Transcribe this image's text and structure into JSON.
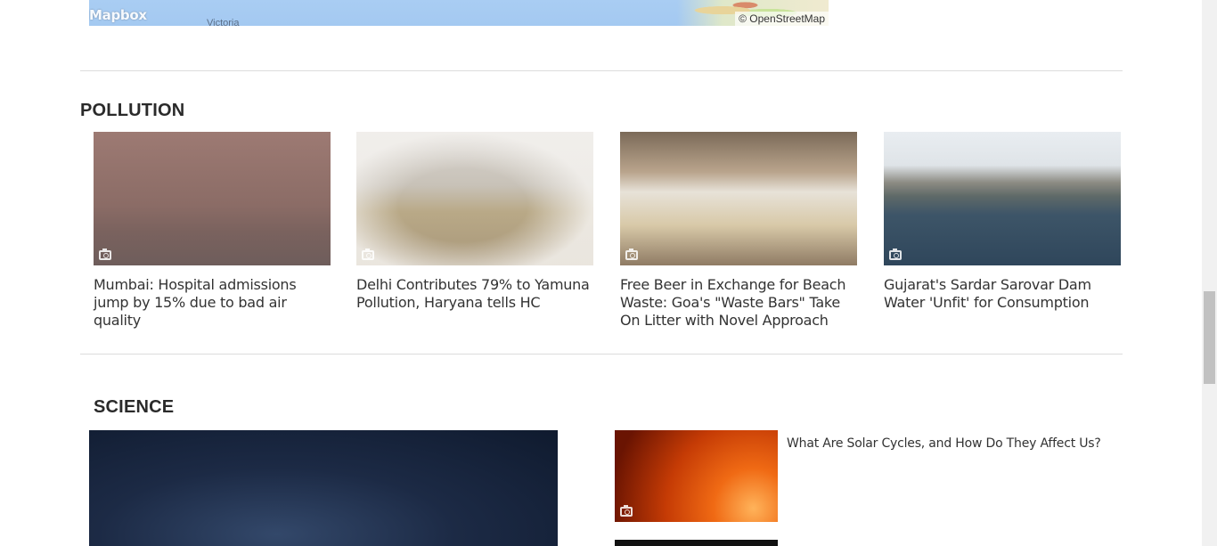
{
  "map": {
    "logo": "Mapbox",
    "city": "Victoria",
    "attribution": "© OpenStreetMap"
  },
  "sections": {
    "pollution": {
      "title": "POLLUTION",
      "cards": [
        {
          "title": "Mumbai: Hospital admissions jump by 15% due to bad air quality",
          "icon": "camera-icon"
        },
        {
          "title": "Delhi Contributes 79% to Yamuna Pollution, Haryana tells HC",
          "icon": "camera-icon"
        },
        {
          "title": "Free Beer in Exchange for Beach Waste: Goa's \"Waste Bars\" Take On Litter with Novel Approach",
          "icon": "camera-icon"
        },
        {
          "title": "Gujarat's Sardar Sarovar Dam Water 'Unfit' for Consumption",
          "icon": "camera-icon"
        }
      ]
    },
    "science": {
      "title": "SCIENCE",
      "side_items": [
        {
          "title": "What Are Solar Cycles, and How Do They Affect Us?",
          "icon": "camera-icon"
        }
      ]
    }
  },
  "colors": {
    "divider": "#dcdcdc",
    "text": "#333333",
    "scrollbar_thumb": "#c1c1c1"
  }
}
